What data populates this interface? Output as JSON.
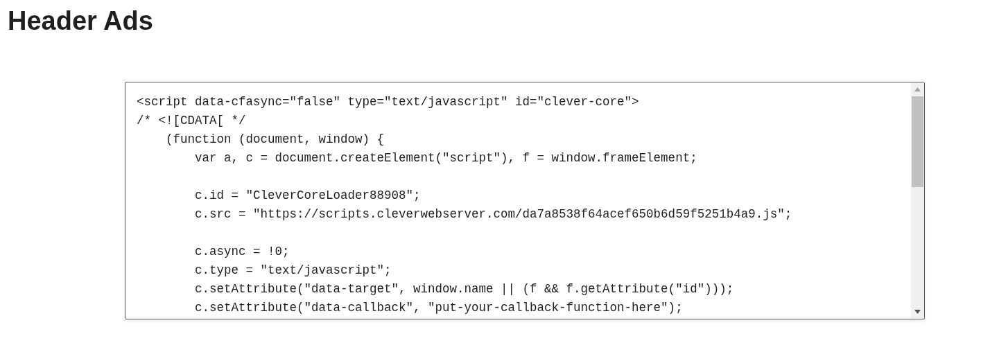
{
  "heading": "Header Ads",
  "code_field": {
    "blocks": [
      [
        "<script data-cfasync=\"false\" type=\"text/javascript\" id=\"clever-core\">",
        "/* <![CDATA[ */",
        "    (function (document, window) {",
        "        var a, c = document.createElement(\"script\"), f = window.frameElement;"
      ],
      [
        "        c.id = \"CleverCoreLoader88908\";",
        "        c.src = \"https://scripts.cleverwebserver.com/da7a8538f64acef650b6d59f5251b4a9.js\";"
      ],
      [
        "        c.async = !0;",
        "        c.type = \"text/javascript\";",
        "        c.setAttribute(\"data-target\", window.name || (f && f.getAttribute(\"id\")));",
        "        c.setAttribute(\"data-callback\", \"put-your-callback-function-here\");"
      ]
    ]
  }
}
